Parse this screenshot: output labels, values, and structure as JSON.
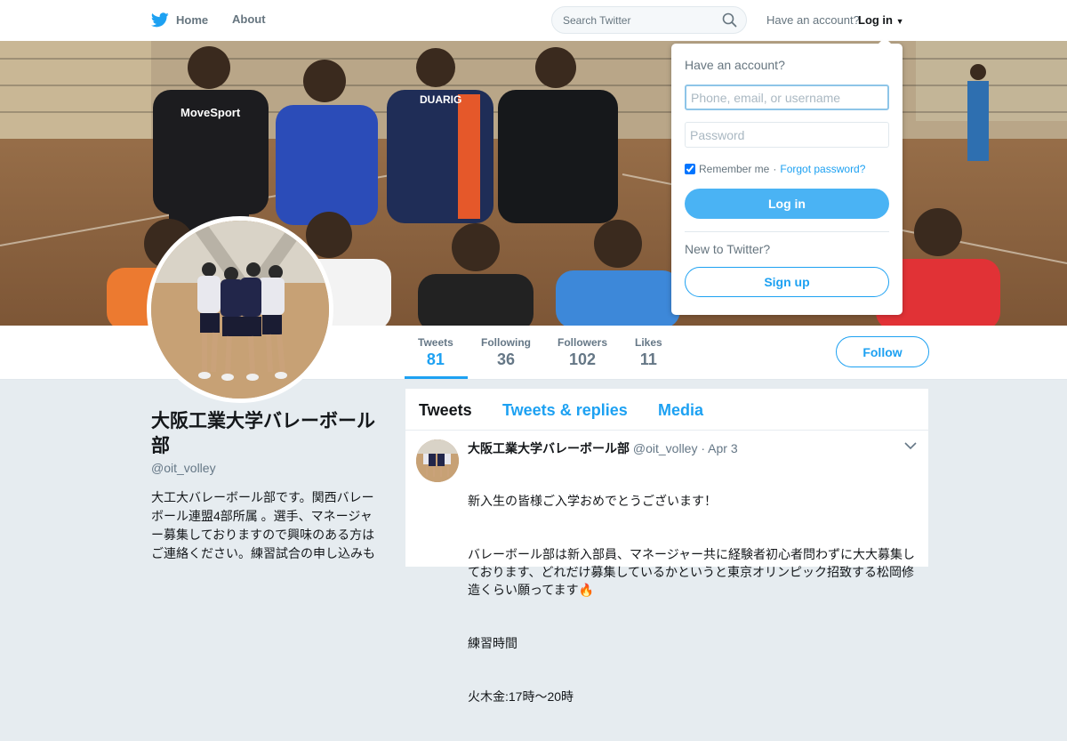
{
  "header": {
    "home_label": "Home",
    "about_label": "About",
    "search_placeholder": "Search Twitter",
    "have_account": "Have an account?",
    "login_label": "Log in"
  },
  "colors": {
    "accent": "#1da1f2",
    "login_button": "#4ab3f4",
    "background": "#e6ecf0"
  },
  "banner": {
    "jersey_1": "MoveSport",
    "jersey_2": "DUARIG"
  },
  "profile": {
    "name": "大阪工業大学バレーボール部",
    "handle": "@oit_volley",
    "bio": "大工大バレーボール部です。関西バレーボール連盟4部所属 。選手、マネージャー募集しておりますので興味のある方はご連絡ください。練習試合の申し込みも"
  },
  "stats": [
    {
      "label": "Tweets",
      "value": "81"
    },
    {
      "label": "Following",
      "value": "36"
    },
    {
      "label": "Followers",
      "value": "102"
    },
    {
      "label": "Likes",
      "value": "11"
    }
  ],
  "follow_label": "Follow",
  "timeline": {
    "tabs": [
      "Tweets",
      "Tweets & replies",
      "Media"
    ],
    "tweet": {
      "name": "大阪工業大学バレーボール部",
      "handle": "@oit_volley",
      "date": "Apr 3",
      "lines": [
        "新入生の皆様ご入学おめでとうございます！",
        "バレーボール部は新入部員、マネージャー共に経験者初心者問わずに大大募集しております、どれだけ募集しているかというと東京オリンピック招致する松岡修造くらい願ってます🔥",
        "練習時間",
        "火木金:17時〜20時"
      ]
    }
  },
  "login_dropdown": {
    "title": "Have an account?",
    "username_placeholder": "Phone, email, or username",
    "password_placeholder": "Password",
    "remember_label": "Remember me",
    "separator": "·",
    "forgot_label": "Forgot password?",
    "login_button": "Log in",
    "new_label": "New to Twitter?",
    "signup_button": "Sign up",
    "remember_checked": true
  }
}
